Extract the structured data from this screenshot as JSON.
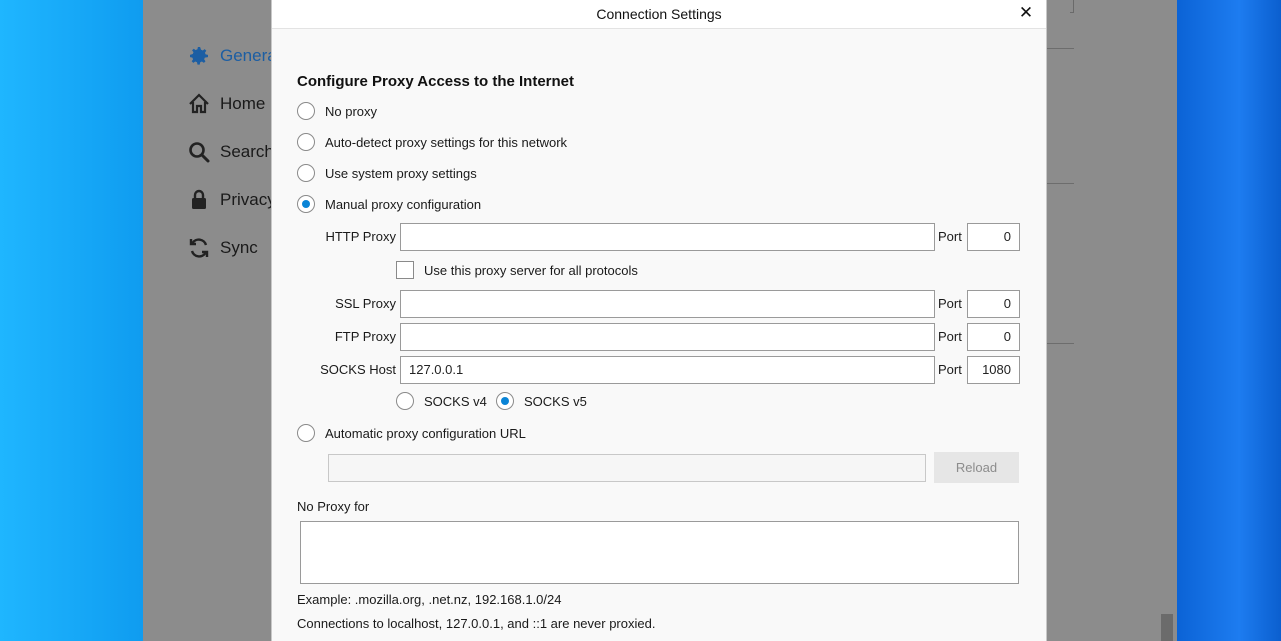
{
  "firefox": {
    "nav": [
      {
        "label": "General",
        "icon": "gear-icon",
        "active": true
      },
      {
        "label": "Home",
        "icon": "home-icon"
      },
      {
        "label": "Search",
        "icon": "search-icon"
      },
      {
        "label": "Privacy",
        "icon": "lock-icon"
      },
      {
        "label": "Sync",
        "icon": "sync-icon"
      }
    ],
    "accent_color": "#1c5ea3"
  },
  "dialog": {
    "title": "Connection Settings",
    "close_glyph": "✕",
    "heading": "Configure Proxy Access to the Internet",
    "proxy_options": [
      {
        "label": "No proxy",
        "checked": false
      },
      {
        "label": "Auto-detect proxy settings for this network",
        "checked": false
      },
      {
        "label": "Use system proxy settings",
        "checked": false
      },
      {
        "label": "Manual proxy configuration",
        "checked": true
      }
    ],
    "http": {
      "label": "HTTP Proxy",
      "value": "",
      "port_label": "Port",
      "port": "0"
    },
    "use_for_all": {
      "label": "Use this proxy server for all protocols",
      "checked": false
    },
    "ssl": {
      "label": "SSL Proxy",
      "value": "",
      "port_label": "Port",
      "port": "0"
    },
    "ftp": {
      "label": "FTP Proxy",
      "value": "",
      "port_label": "Port",
      "port": "0"
    },
    "socks": {
      "label": "SOCKS Host",
      "value": "127.0.0.1",
      "port_label": "Port",
      "port": "1080"
    },
    "socks_version": [
      {
        "label": "SOCKS v4",
        "checked": false
      },
      {
        "label": "SOCKS v5",
        "checked": true
      }
    ],
    "auto_url": {
      "label": "Automatic proxy configuration URL",
      "checked": false,
      "value": "",
      "reload_label": "Reload"
    },
    "no_proxy": {
      "label": "No Proxy for",
      "value": ""
    },
    "example_text": "Example: .mozilla.org, .net.nz, 192.168.1.0/24",
    "localhost_text": "Connections to localhost, 127.0.0.1, and ::1 are never proxied.",
    "radio_color": "#0a84d6"
  }
}
